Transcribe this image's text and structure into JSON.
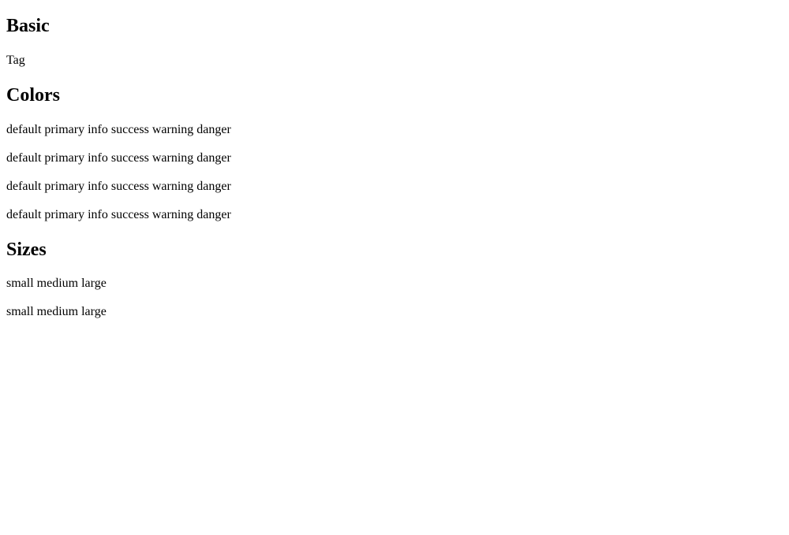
{
  "sections": {
    "basic": {
      "title": "Basic",
      "rows": [
        [
          "Tag"
        ]
      ]
    },
    "colors": {
      "title": "Colors",
      "rows": [
        [
          "default",
          "primary",
          "info",
          "success",
          "warning",
          "danger"
        ],
        [
          "default",
          "primary",
          "info",
          "success",
          "warning",
          "danger"
        ],
        [
          "default",
          "primary",
          "info",
          "success",
          "warning",
          "danger"
        ],
        [
          "default",
          "primary",
          "info",
          "success",
          "warning",
          "danger"
        ]
      ]
    },
    "sizes": {
      "title": "Sizes",
      "rows": [
        [
          "small",
          "medium",
          "large"
        ],
        [
          "small",
          "medium",
          "large"
        ]
      ]
    }
  }
}
